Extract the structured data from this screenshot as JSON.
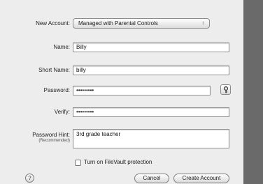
{
  "form": {
    "new_account_label": "New Account:",
    "new_account_value": "Managed with Parental Controls",
    "select_arrows": "↕",
    "name_label": "Name:",
    "name_value": "Billy",
    "short_name_label": "Short Name:",
    "short_name_value": "billy",
    "password_label": "Password:",
    "password_value": "•••••••••",
    "verify_label": "Verify:",
    "verify_value": "•••••••••",
    "hint_label": "Password Hint:",
    "hint_sublabel": "(Recommended)",
    "hint_value": "3rd grade teacher",
    "filevault_label": "Turn on FileVault protection",
    "filevault_checked": false
  },
  "footer": {
    "help_label": "?",
    "cancel_label": "Cancel",
    "create_label": "Create Account"
  },
  "icons": {
    "password_assistant": "key-icon"
  }
}
